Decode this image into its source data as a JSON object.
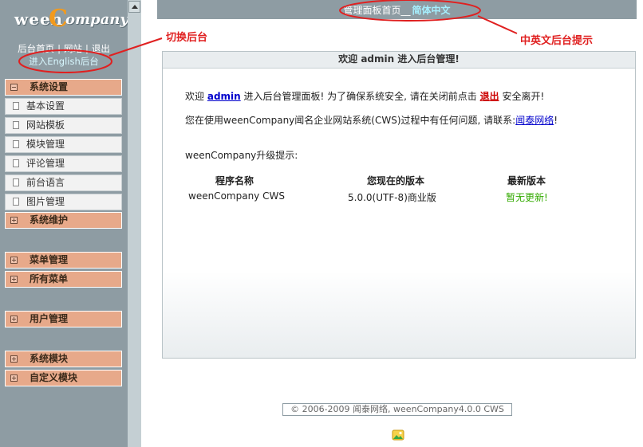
{
  "sidebar": {
    "logo_text": "weenCompany",
    "top_links": [
      "后台首页",
      "网站",
      "退出"
    ],
    "english_link": "进入English后台",
    "groups": [
      {
        "label": "系统设置",
        "expanded": true,
        "items": [
          "基本设置",
          "网站模板",
          "模块管理",
          "评论管理",
          "前台语言",
          "图片管理"
        ]
      },
      {
        "label": "系统维护",
        "expanded": false
      },
      {
        "label": "菜单管理",
        "expanded": false
      },
      {
        "label": "所有菜单",
        "expanded": false
      },
      {
        "label": "用户管理",
        "expanded": false
      },
      {
        "label": "系统模块",
        "expanded": false
      },
      {
        "label": "自定义模块",
        "expanded": false
      }
    ]
  },
  "header": {
    "title": "管理面板首页",
    "separator": "__",
    "language": "简体中文"
  },
  "panel": {
    "title": "欢迎 admin 进入后台管理!",
    "welcome_prefix": "欢迎",
    "username": "admin",
    "welcome_mid": "进入后台管理面板! 为了确保系统安全, 请在关闭前点击",
    "logout": "退出",
    "welcome_suffix": "安全离开!",
    "contact_prefix": "您在使用weenCompany闻名企业网站系统(CWS)过程中有任何问题, 请联系:",
    "contact_link": "闻泰网络",
    "contact_suffix": "!",
    "upgrade_title": "weenCompany升级提示:",
    "columns": [
      "程序名称",
      "您现在的版本",
      "最新版本"
    ],
    "row": [
      "weenCompany CWS",
      "5.0.0(UTF-8)商业版",
      "暂无更新!"
    ]
  },
  "footer": "© 2006-2009 闻泰网络, weenCompany4.0.0 CWS",
  "annotations": {
    "switch_backend": "切换后台",
    "language_hint": "中英文后台提示"
  },
  "colors": {
    "sidebar": "#8e9ca3",
    "menu_head": "#e7a98a",
    "annotation": "#e02020",
    "latest": "#33aa00"
  }
}
